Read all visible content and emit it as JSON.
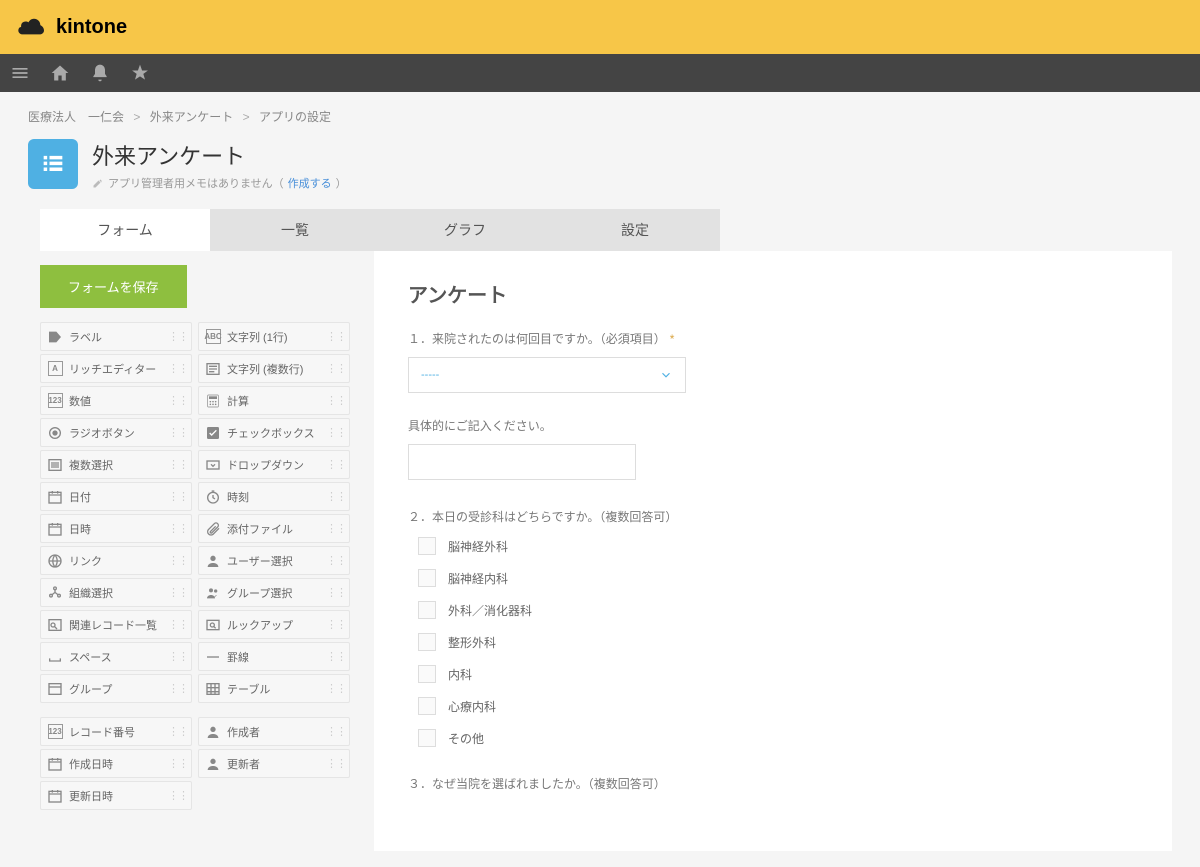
{
  "brand": "kintone",
  "breadcrumb": {
    "org": "医療法人　一仁会",
    "app": "外来アンケート",
    "page": "アプリの設定"
  },
  "app": {
    "title": "外来アンケート",
    "memo_prefix": "アプリ管理者用メモはありません（",
    "memo_link": "作成する",
    "memo_suffix": "）"
  },
  "tabs": {
    "form": "フォーム",
    "list": "一覧",
    "graph": "グラフ",
    "settings": "設定"
  },
  "save_btn": "フォームを保存",
  "fields_a": [
    {
      "icon": "label",
      "label": "ラベル"
    },
    {
      "icon": "text1",
      "label": "文字列 (1行)"
    },
    {
      "icon": "rich",
      "label": "リッチエディター"
    },
    {
      "icon": "textmulti",
      "label": "文字列 (複数行)"
    },
    {
      "icon": "num",
      "label": "数値"
    },
    {
      "icon": "calc",
      "label": "計算"
    },
    {
      "icon": "radio",
      "label": "ラジオボタン"
    },
    {
      "icon": "check",
      "label": "チェックボックス"
    },
    {
      "icon": "multisel",
      "label": "複数選択"
    },
    {
      "icon": "dropdown",
      "label": "ドロップダウン"
    },
    {
      "icon": "date",
      "label": "日付"
    },
    {
      "icon": "time",
      "label": "時刻"
    },
    {
      "icon": "datetime",
      "label": "日時"
    },
    {
      "icon": "attach",
      "label": "添付ファイル"
    },
    {
      "icon": "link",
      "label": "リンク"
    },
    {
      "icon": "user",
      "label": "ユーザー選択"
    },
    {
      "icon": "org",
      "label": "組織選択"
    },
    {
      "icon": "group",
      "label": "グループ選択"
    },
    {
      "icon": "related",
      "label": "関連レコード一覧"
    },
    {
      "icon": "lookup",
      "label": "ルックアップ"
    },
    {
      "icon": "space",
      "label": "スペース"
    },
    {
      "icon": "line",
      "label": "罫線"
    },
    {
      "icon": "groupf",
      "label": "グループ"
    },
    {
      "icon": "table",
      "label": "テーブル"
    }
  ],
  "fields_b": [
    {
      "icon": "recno",
      "label": "レコード番号"
    },
    {
      "icon": "creator",
      "label": "作成者"
    },
    {
      "icon": "created",
      "label": "作成日時"
    },
    {
      "icon": "updater",
      "label": "更新者"
    },
    {
      "icon": "updated",
      "label": "更新日時"
    }
  ],
  "canvas": {
    "title": "アンケート",
    "q1": "１．来院されたのは何回目ですか。（必須項目）",
    "dropdown_val": "-----",
    "q1b": "具体的にご記入ください。",
    "q2": "２．本日の受診科はどちらですか。（複数回答可）",
    "q2_options": [
      "脳神経外科",
      "脳神経内科",
      "外科／消化器科",
      "整形外科",
      "内科",
      "心療内科",
      "その他"
    ],
    "q3": "３．なぜ当院を選ばれましたか。（複数回答可）"
  }
}
